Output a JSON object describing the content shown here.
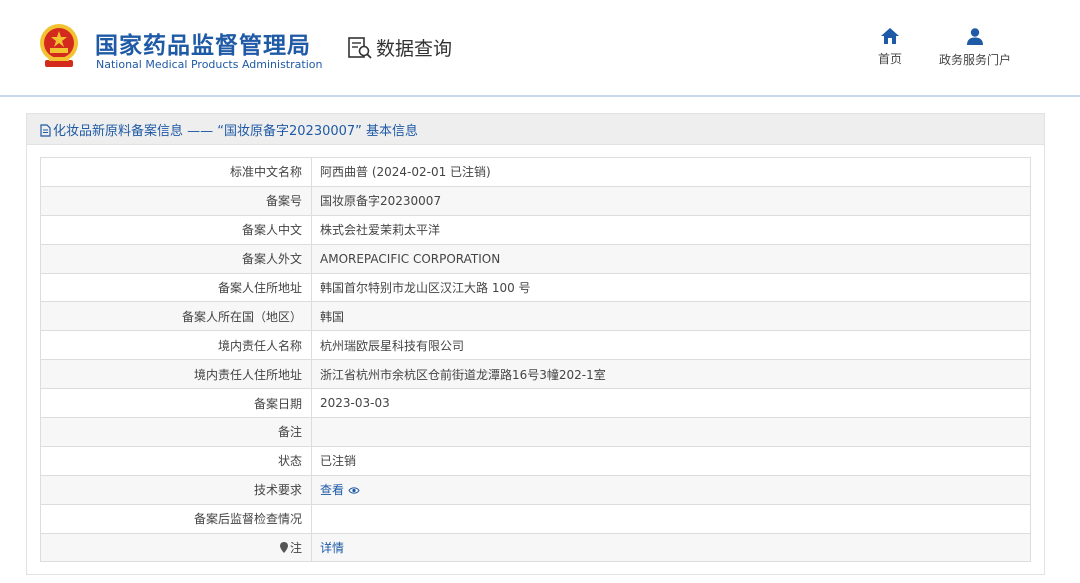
{
  "header": {
    "org_name_cn": "国家药品监督管理局",
    "org_name_en": "National Medical Products Administration",
    "query_label": "数据查询",
    "nav": [
      {
        "label": "首页",
        "icon": "home-icon"
      },
      {
        "label": "政务服务门户",
        "icon": "user-icon"
      }
    ]
  },
  "panel": {
    "title": "化妆品新原料备案信息 —— “国妆原备字20230007” 基本信息"
  },
  "record": {
    "rows": [
      {
        "label": "标准中文名称",
        "value": "阿西曲普 (2024-02-01 已注销)"
      },
      {
        "label": "备案号",
        "value": "国妆原备字20230007"
      },
      {
        "label": "备案人中文",
        "value": "株式会社爱茉莉太平洋"
      },
      {
        "label": "备案人外文",
        "value": "AMOREPACIFIC CORPORATION"
      },
      {
        "label": "备案人住所地址",
        "value": "韩国首尔特别市龙山区汉江大路 100 号"
      },
      {
        "label": "备案人所在国（地区）",
        "value": "韩国"
      },
      {
        "label": "境内责任人名称",
        "value": "杭州瑞欧辰星科技有限公司"
      },
      {
        "label": "境内责任人住所地址",
        "value": "浙江省杭州市余杭区仓前街道龙潭路16号3幢202-1室"
      },
      {
        "label": "备案日期",
        "value": "2023-03-03"
      },
      {
        "label": "备注",
        "value": ""
      },
      {
        "label": "状态",
        "value": "已注销"
      },
      {
        "label": "技术要求",
        "value": "查看"
      },
      {
        "label": "备案后监督检查情况",
        "value": ""
      },
      {
        "label": "注",
        "value": "详情"
      }
    ]
  },
  "colors": {
    "brand_blue": "#1f5aa6",
    "emblem_red": "#d42a1e",
    "emblem_gold": "#f2c230"
  }
}
